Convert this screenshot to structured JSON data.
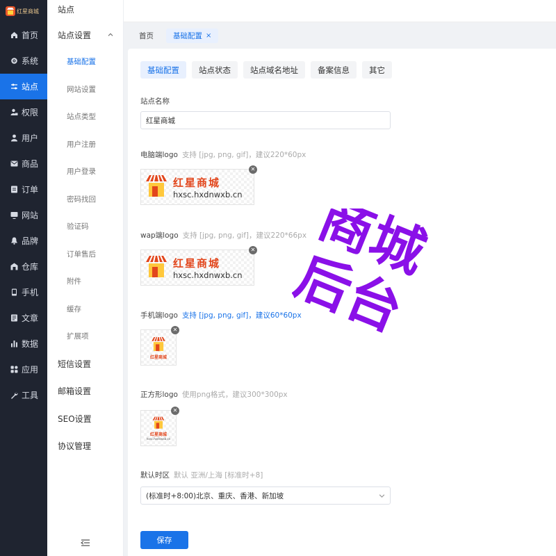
{
  "brand": {
    "logo_text": "红星商城"
  },
  "nav": [
    {
      "label": "首页",
      "icon": "home-icon"
    },
    {
      "label": "系统",
      "icon": "gear-icon"
    },
    {
      "label": "站点",
      "icon": "sliders-icon",
      "active": true
    },
    {
      "label": "权限",
      "icon": "user-lock-icon"
    },
    {
      "label": "用户",
      "icon": "user-icon"
    },
    {
      "label": "商品",
      "icon": "mail-icon"
    },
    {
      "label": "订单",
      "icon": "order-icon"
    },
    {
      "label": "网站",
      "icon": "monitor-icon"
    },
    {
      "label": "品牌",
      "icon": "bell-icon"
    },
    {
      "label": "仓库",
      "icon": "warehouse-icon"
    },
    {
      "label": "手机",
      "icon": "phone-icon"
    },
    {
      "label": "文章",
      "icon": "article-icon"
    },
    {
      "label": "数据",
      "icon": "bar-chart-icon"
    },
    {
      "label": "应用",
      "icon": "apps-icon"
    },
    {
      "label": "工具",
      "icon": "wrench-icon"
    }
  ],
  "submenu": {
    "title": "站点",
    "group_label": "站点设置",
    "items": [
      "基础配置",
      "网站设置",
      "站点类型",
      "用户注册",
      "用户登录",
      "密码找回",
      "验证码",
      "订单售后",
      "附件",
      "缓存",
      "扩展项"
    ],
    "active_index": 0,
    "top_items": [
      "短信设置",
      "邮箱设置",
      "SEO设置",
      "协议管理"
    ]
  },
  "tabs": [
    {
      "label": "首页",
      "active": false
    },
    {
      "label": "基础配置",
      "active": true,
      "close": "×"
    }
  ],
  "content_tabs": [
    "基础配置",
    "站点状态",
    "站点域名地址",
    "备案信息",
    "其它"
  ],
  "form": {
    "site_name": {
      "label": "站点名称",
      "value": "红星商城"
    },
    "pc_logo": {
      "label": "电脑端logo",
      "hint": "支持 [jpg, png, gif]，建议220*60px"
    },
    "wap_logo": {
      "label": "wap端logo",
      "hint": "支持 [jpg, png, gif]，建议220*66px"
    },
    "mobile_logo": {
      "label": "手机端logo",
      "hint": "支持 [jpg, png, gif]，建议60*60px"
    },
    "square_logo": {
      "label": "正方形logo",
      "hint": "使用png格式，建议300*300px"
    },
    "timezone": {
      "label": "默认时区",
      "hint": "默认 亚洲/上海 [标准时+8]",
      "value": "(标准时+8:00)北京、重庆、香港、新加坡"
    },
    "save_label": "保存"
  },
  "logo_preview": {
    "cn": "红星商城",
    "en": "hxsc.hxdnwxb.cn",
    "en_small": "hxsc.hxdnwxb.cn"
  },
  "watermark": {
    "line1": "商城",
    "line2": "后台",
    "color": "#8a10e8"
  },
  "colors": {
    "primary": "#1a73e8",
    "sidebar": "#1f2430"
  }
}
